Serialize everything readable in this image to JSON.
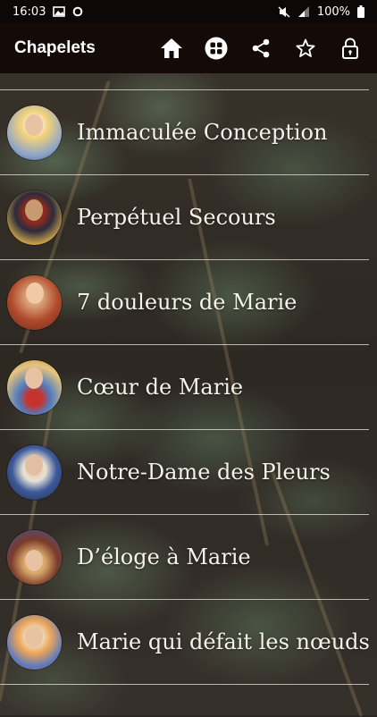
{
  "status": {
    "time": "16:03",
    "battery": "100%"
  },
  "appbar": {
    "title": "Chapelets",
    "icons": [
      "home-icon",
      "grid-icon",
      "share-icon",
      "star-icon",
      "lock-icon"
    ]
  },
  "items": [
    {
      "label": "Immaculée Conception",
      "colors": [
        "#f3d27a",
        "#8aa3c9",
        "#f6efe0"
      ]
    },
    {
      "label": "Perpétuel Secours",
      "colors": [
        "#c9a34a",
        "#2c2b3c",
        "#8b2a1f"
      ]
    },
    {
      "label": "7 douleurs de Marie",
      "colors": [
        "#b04a2c",
        "#d9a37a",
        "#6a2c20"
      ]
    },
    {
      "label": "Cœur de Marie",
      "colors": [
        "#e7c47c",
        "#4f7bbf",
        "#c7332c"
      ]
    },
    {
      "label": "Notre-Dame des Pleurs",
      "colors": [
        "#3d5a9a",
        "#e9e2d4",
        "#1f2a48"
      ]
    },
    {
      "label": "D’éloge à Marie",
      "colors": [
        "#d9a86a",
        "#7a3a2a",
        "#3c5aa0"
      ]
    },
    {
      "label": "Marie qui défait les nœuds",
      "colors": [
        "#e9a35a",
        "#5a7abf",
        "#c94a3a"
      ]
    }
  ]
}
